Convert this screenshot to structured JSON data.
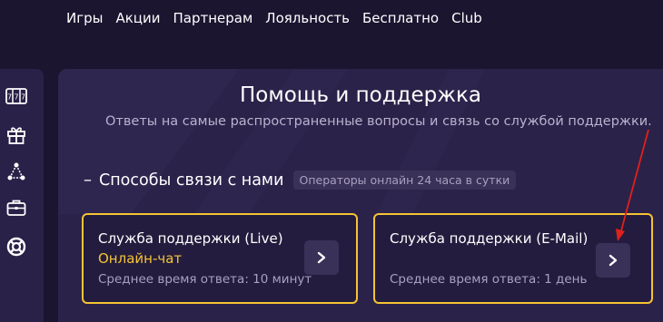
{
  "nav": {
    "items": [
      "Игры",
      "Акции",
      "Партнерам",
      "Лояльность",
      "Бесплатно",
      "Club"
    ]
  },
  "sidebar": {
    "icons": [
      "slot-machine-icon",
      "gift-icon",
      "network-icon",
      "briefcase-icon",
      "lifebuoy-icon"
    ]
  },
  "support": {
    "title": "Помощь и поддержка",
    "subtitle": "Ответы на самые распространенные вопросы и связь со службой поддержки.",
    "section": {
      "toggle": "–",
      "title": "Способы связи с нами",
      "badge": "Операторы онлайн 24 часа в сутки"
    },
    "cards": {
      "live": {
        "title": "Служба поддержки (Live)",
        "status": "Онлайн-чат",
        "time": "Среднее время ответа: 10 минут"
      },
      "mail": {
        "title": "Служба поддержки (E-Mail)",
        "time": "Среднее время ответа: 1 день"
      }
    }
  },
  "colors": {
    "background": "#1b1530",
    "panel": "#2b2249",
    "accent": "#f5c434",
    "annotation_arrow": "#e0201b"
  }
}
